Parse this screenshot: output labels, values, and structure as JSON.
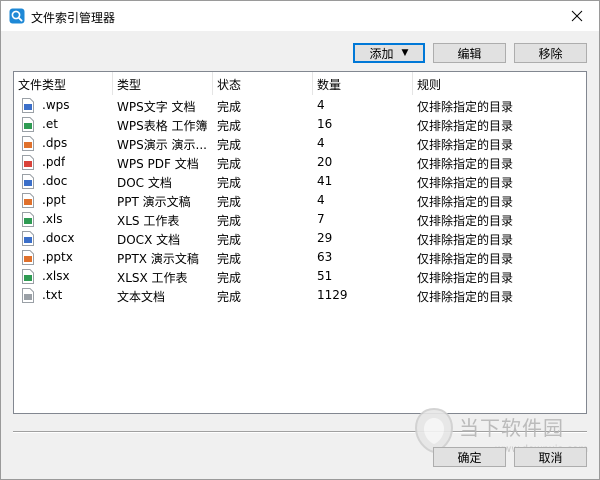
{
  "window": {
    "title": "文件索引管理器"
  },
  "toolbar": {
    "add_label": "添加",
    "edit_label": "编辑",
    "remove_label": "移除"
  },
  "columns": [
    "文件类型",
    "类型",
    "状态",
    "数量",
    "规则"
  ],
  "rows": [
    {
      "ext": ".wps",
      "type": "WPS文字 文档",
      "status": "完成",
      "count": "4",
      "rule": "仅排除指定的目录",
      "icon": "wps-doc-icon",
      "color": "#3b6fc9"
    },
    {
      "ext": ".et",
      "type": "WPS表格 工作簿",
      "status": "完成",
      "count": "16",
      "rule": "仅排除指定的目录",
      "icon": "et-sheet-icon",
      "color": "#2f9b53"
    },
    {
      "ext": ".dps",
      "type": "WPS演示 演示...",
      "status": "完成",
      "count": "4",
      "rule": "仅排除指定的目录",
      "icon": "dps-slide-icon",
      "color": "#e0712c"
    },
    {
      "ext": ".pdf",
      "type": "WPS PDF 文档",
      "status": "完成",
      "count": "20",
      "rule": "仅排除指定的目录",
      "icon": "pdf-icon",
      "color": "#d9423a"
    },
    {
      "ext": ".doc",
      "type": "DOC 文档",
      "status": "完成",
      "count": "41",
      "rule": "仅排除指定的目录",
      "icon": "doc-icon",
      "color": "#3b6fc9"
    },
    {
      "ext": ".ppt",
      "type": "PPT 演示文稿",
      "status": "完成",
      "count": "4",
      "rule": "仅排除指定的目录",
      "icon": "ppt-icon",
      "color": "#e0712c"
    },
    {
      "ext": ".xls",
      "type": "XLS 工作表",
      "status": "完成",
      "count": "7",
      "rule": "仅排除指定的目录",
      "icon": "xls-icon",
      "color": "#2f9b53"
    },
    {
      "ext": ".docx",
      "type": "DOCX 文档",
      "status": "完成",
      "count": "29",
      "rule": "仅排除指定的目录",
      "icon": "docx-icon",
      "color": "#3b6fc9"
    },
    {
      "ext": ".pptx",
      "type": "PPTX 演示文稿",
      "status": "完成",
      "count": "63",
      "rule": "仅排除指定的目录",
      "icon": "pptx-icon",
      "color": "#e0712c"
    },
    {
      "ext": ".xlsx",
      "type": "XLSX 工作表",
      "status": "完成",
      "count": "51",
      "rule": "仅排除指定的目录",
      "icon": "xlsx-icon",
      "color": "#2f9b53"
    },
    {
      "ext": ".txt",
      "type": "文本文档",
      "status": "完成",
      "count": "1129",
      "rule": "仅排除指定的目录",
      "icon": "txt-icon",
      "color": "#9aa0a6"
    }
  ],
  "footer": {
    "ok_label": "确定",
    "cancel_label": "取消"
  },
  "watermark": {
    "text": "当下软件园",
    "url": "www.downxia.com"
  }
}
